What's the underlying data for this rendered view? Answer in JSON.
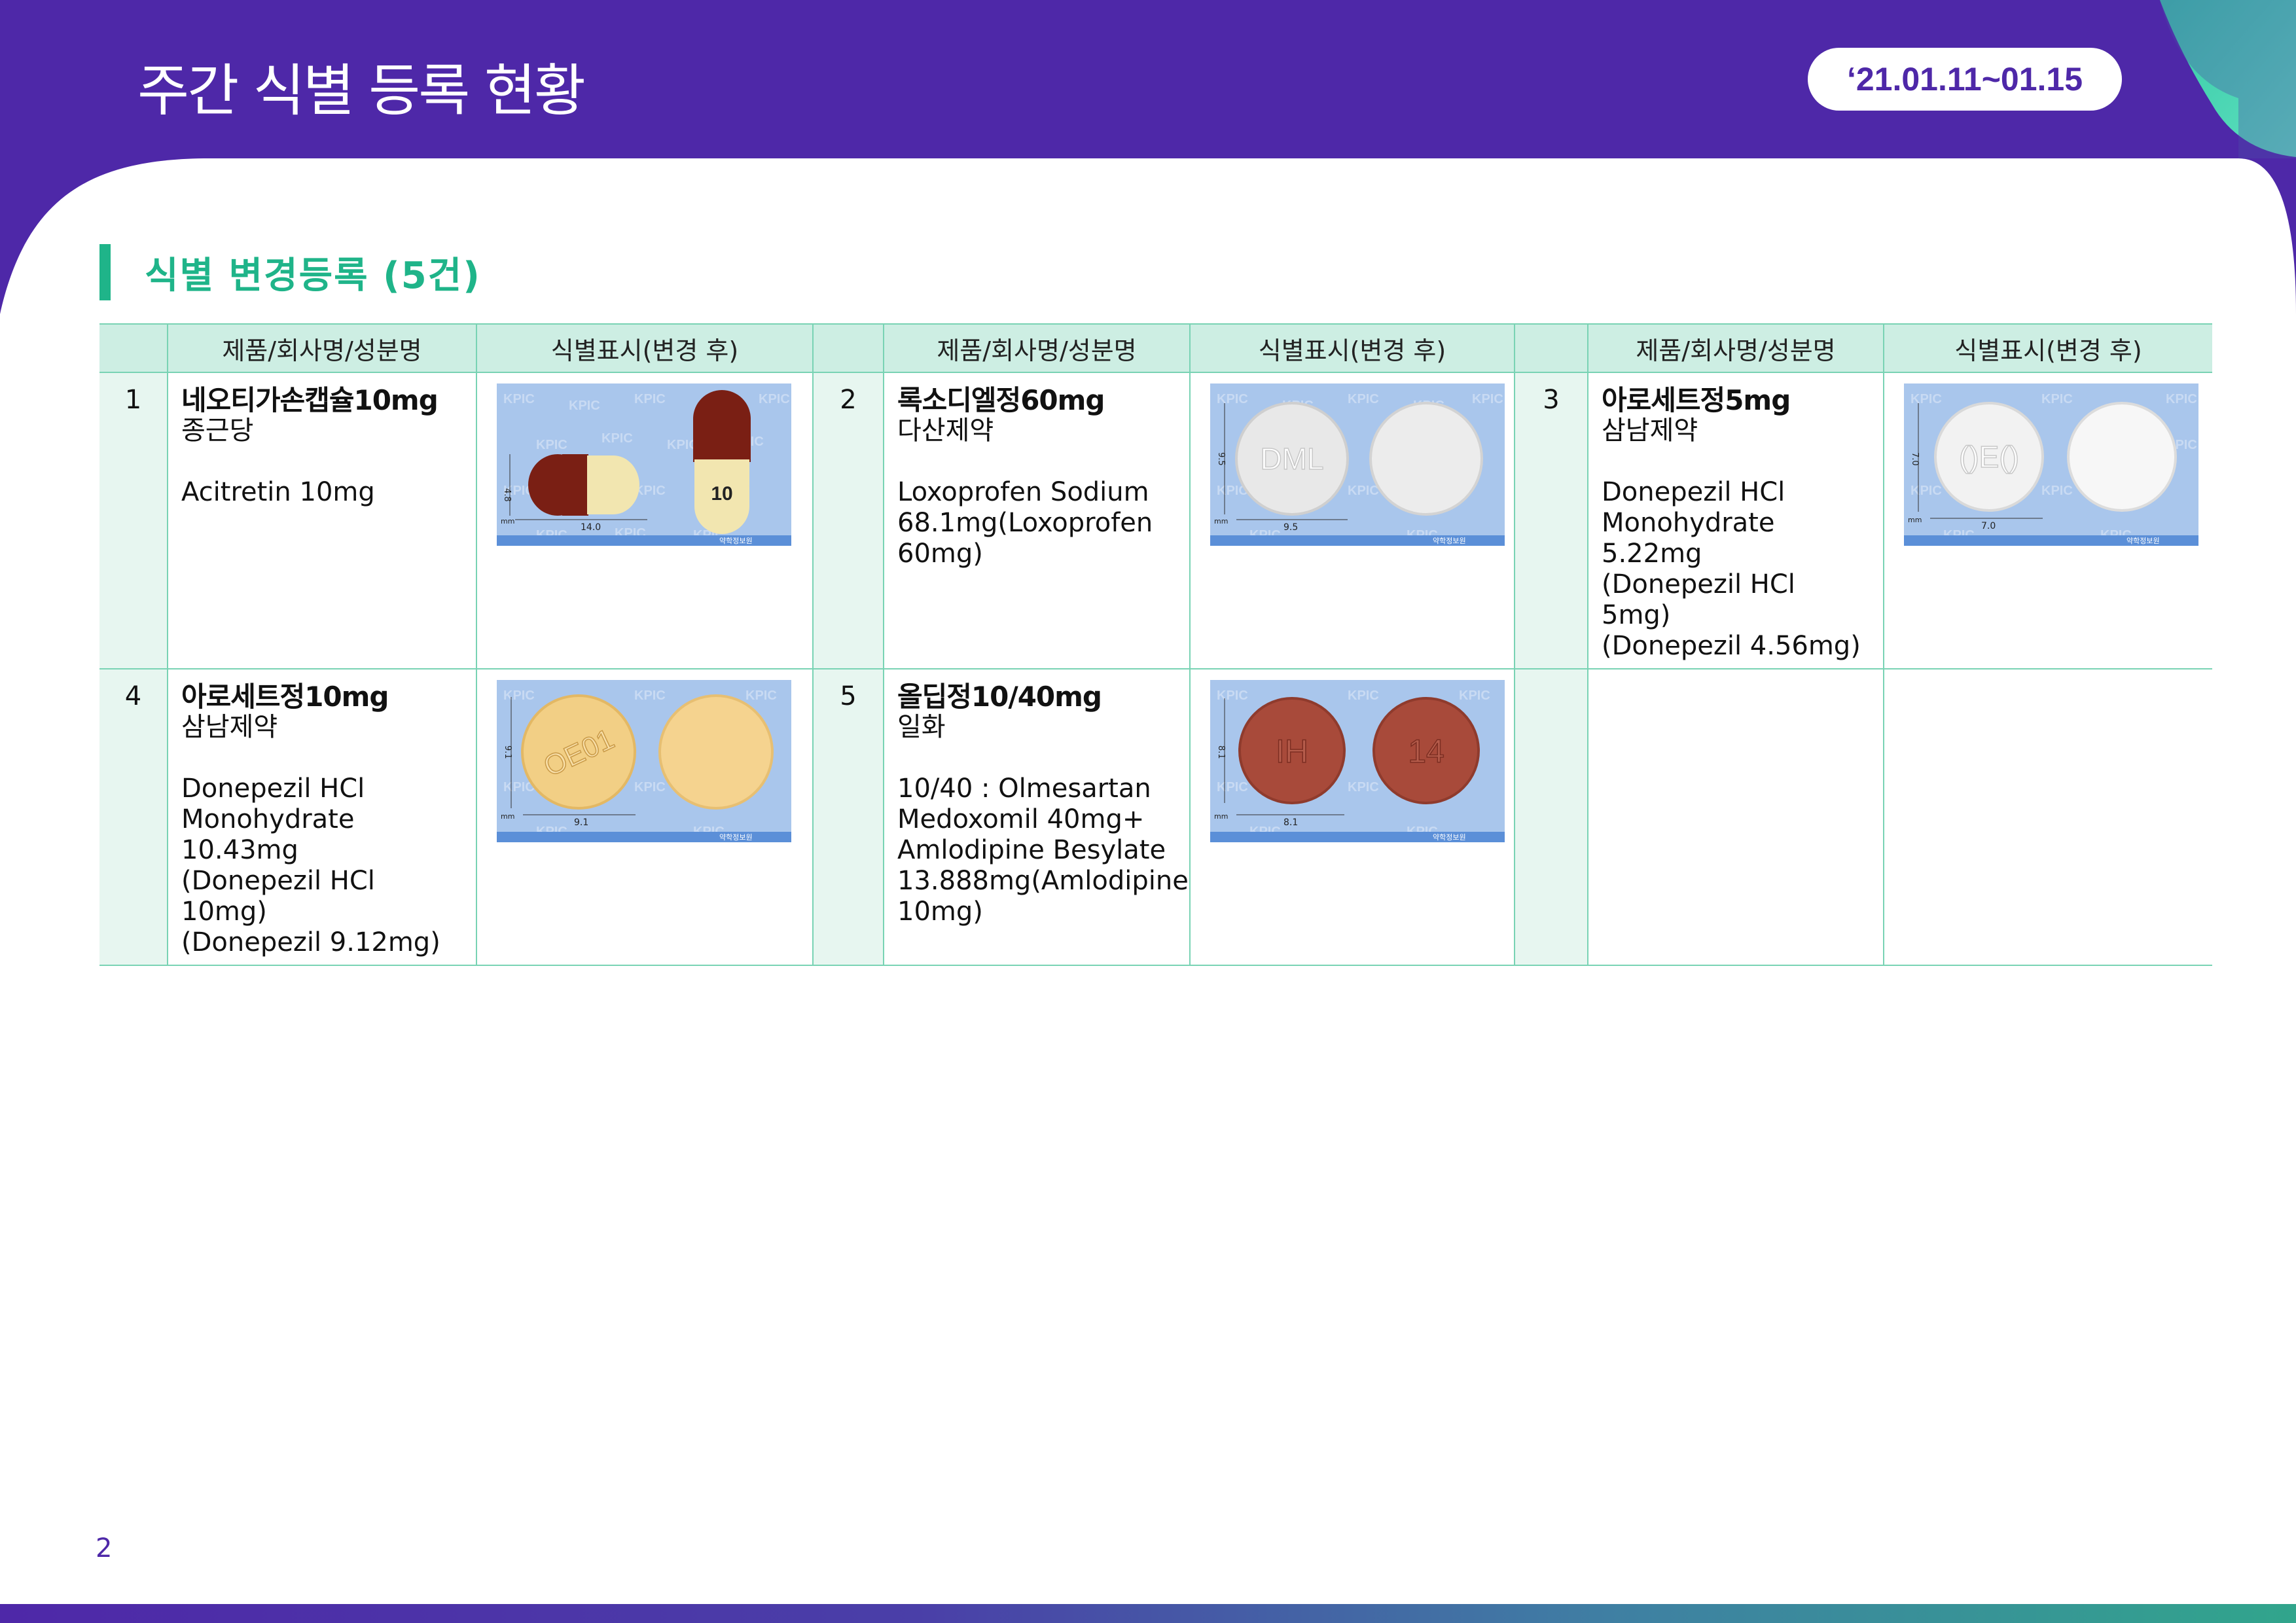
{
  "header": {
    "title": "주간 식별 등록 현황",
    "date_range": "‘21.01.11~01.15"
  },
  "section": {
    "title": "식별 변경등록 (5건)"
  },
  "table": {
    "col_product": "제품/회사명/성분명",
    "col_mark": "식별표시(변경 후)",
    "rows": [
      [
        {
          "num": "1",
          "name": "네오티가손캡슐10mg",
          "company": "종근당",
          "ingredient": "Acitretin 10mg",
          "dims": {
            "h": "4.8",
            "w": "14.0"
          },
          "imprint": "10",
          "form": "capsule"
        },
        {
          "num": "2",
          "name": "록소디엘정60mg",
          "company": "다산제약",
          "ingredient": "Loxoprofen Sodium\n68.1mg(Loxoprofen\n60mg)",
          "dims": {
            "h": "9.5",
            "w": "9.5"
          },
          "imprint": "DML",
          "form": "white"
        },
        {
          "num": "3",
          "name": "아로세트정5mg",
          "company": "삼남제약",
          "ingredient": "Donepezil HCl\nMonohydrate 5.22mg\n(Donepezil HCl 5mg)\n(Donepezil 4.56mg)",
          "dims": {
            "h": "7.0",
            "w": "7.0"
          },
          "imprint": "()E()",
          "form": "white"
        }
      ],
      [
        {
          "num": "4",
          "name": "아로세트정10mg",
          "company": "삼남제약",
          "ingredient": "Donepezil HCl\nMonohydrate 10.43mg\n(Donepezil HCl 10mg)\n(Donepezil 9.12mg)",
          "dims": {
            "h": "9.1",
            "w": "9.1"
          },
          "imprint": "OE01",
          "form": "yellow"
        },
        {
          "num": "5",
          "name": "올딥정10/40mg",
          "company": "일화",
          "ingredient": "10/40 : Olmesartan\nMedoxomil 40mg+\nAmlodipine Besylate\n13.888mg(Amlodipine\n10mg)",
          "dims": {
            "h": "8.1",
            "w": "8.1"
          },
          "imprint": "IH",
          "imprint2": "14",
          "form": "red"
        }
      ]
    ]
  },
  "photo_label": "KPIC",
  "photo_unit": "mm",
  "photo_footer": "약학정보원",
  "page_number": "2",
  "colors": {
    "purple": "#4e28a8",
    "green": "#1fb489",
    "mint": "#cdeee3",
    "photo_bg": "#a9c6ec"
  }
}
